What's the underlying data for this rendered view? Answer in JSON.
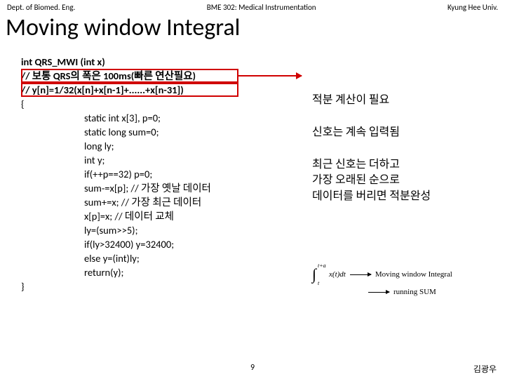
{
  "header": {
    "left": "Dept. of Biomed. Eng.",
    "center": "BME 302: Medical Instrumentation",
    "right": "Kyung Hee Univ."
  },
  "title": "Moving window Integral",
  "code": {
    "sig": "int QRS_MWI (int x)",
    "c1": "// 보통 QRS의 폭은 100ms(빠른 연산필요)",
    "c2": "// y[n]=1/32(x[n]+x[n-1]+......+x[n-31])",
    "l_open": "{",
    "l1": "static int x[3], p=0;",
    "l2": "static long sum=0;",
    "l3": "long ly;",
    "l4": "int y;",
    "l5": "if(++p==32) p=0;",
    "l6": "sum-=x[p]; // 가장 옛날 데이터",
    "l7": "sum+=x; // 가장 최근 데이터",
    "l8": "x[p]=x; // 데이터 교체",
    "l9": "ly=(sum>>5);",
    "l10": "if(ly>32400) y=32400;",
    "l11": "else y=(int)ly;",
    "l12": "return(y);",
    "l_close": "}"
  },
  "annot": {
    "a1": "적분 계산이 필요",
    "a2": "신호는 계속 입력됨",
    "a3": "최근 신호는 더하고\n가장 오래된 순으로\n데이터를 버리면 적분완성"
  },
  "eq": {
    "int_upper": "t+a",
    "int_lower": "t",
    "expr": "x(t)dt",
    "lbl1": "Moving window Integral",
    "lbl2": "running SUM"
  },
  "footer": {
    "page": "9",
    "author": "김광우"
  }
}
